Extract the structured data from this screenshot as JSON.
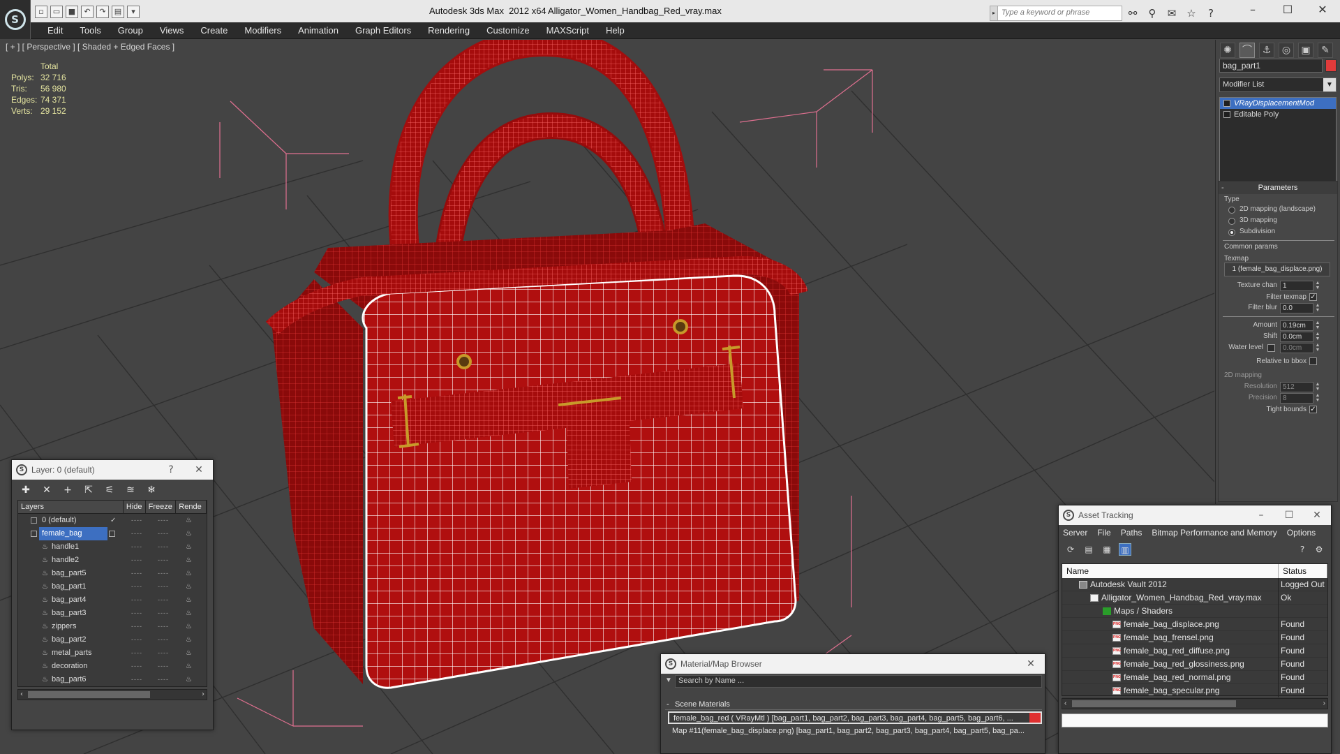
{
  "app": {
    "title": "Autodesk 3ds Max  2012 x64",
    "file": "Alligator_Women_Handbag_Red_vray.max",
    "search_placeholder": "Type a keyword or phrase"
  },
  "menu": [
    "Edit",
    "Tools",
    "Group",
    "Views",
    "Create",
    "Modifiers",
    "Animation",
    "Graph Editors",
    "Rendering",
    "Customize",
    "MAXScript",
    "Help"
  ],
  "viewport": {
    "label": "[ + ] [ Perspective ] [ Shaded + Edged Faces ]",
    "stats": {
      "total": "Total",
      "polys_label": "Polys:",
      "polys": "32 716",
      "tris_label": "Tris:",
      "tris": "56 980",
      "edges_label": "Edges:",
      "edges": "74 371",
      "verts_label": "Verts:",
      "verts": "29 152"
    },
    "colors": {
      "background": "#444444",
      "grid": "#2f2f2f",
      "wire": "#ffffff",
      "mesh": "#b00f0f",
      "bbox": "#e07090"
    }
  },
  "command_panel": {
    "object_name": "bag_part1",
    "modifier_list": "Modifier List",
    "stack": [
      "VRayDisplacementMod",
      "Editable Poly"
    ],
    "parameters": {
      "title": "Parameters",
      "type_label": "Type",
      "options": [
        "2D mapping (landscape)",
        "3D mapping",
        "Subdivision"
      ],
      "common_label": "Common params",
      "texmap_label": "Texmap",
      "texmap_value": "1 (female_bag_displace.png)",
      "texture_chan_label": "Texture chan",
      "texture_chan": "1",
      "filter_texmap_label": "Filter texmap",
      "filter_blur_label": "Filter blur",
      "filter_blur": "0.0",
      "amount_label": "Amount",
      "amount": "0.19cm",
      "shift_label": "Shift",
      "shift": "0.0cm",
      "water_level_label": "Water level",
      "water_level": "0.0cm",
      "relative_label": "Relative to bbox",
      "mapping2d_label": "2D mapping",
      "resolution_label": "Resolution",
      "resolution": "512",
      "precision_label": "Precision",
      "precision": "8",
      "tight_label": "Tight bounds"
    }
  },
  "layers": {
    "title": "Layer: 0 (default)",
    "help": "?",
    "columns": [
      "Layers",
      "Hide",
      "Freeze",
      "Rende"
    ],
    "items": [
      "0 (default)",
      "female_bag",
      "handle1",
      "handle2",
      "bag_part5",
      "bag_part1",
      "bag_part4",
      "bag_part3",
      "zippers",
      "bag_part2",
      "metal_parts",
      "decoration",
      "bag_part6",
      "female_bag"
    ],
    "dashes": "----"
  },
  "material_browser": {
    "title": "Material/Map Browser",
    "search": "Search by Name ...",
    "section": "Scene Materials",
    "rows": [
      "female_bag_red  ( VRayMtl ) [bag_part1, bag_part2, bag_part3, bag_part4, bag_part5, bag_part6, ...",
      "Map #11(female_bag_displace.png) [bag_part1, bag_part2, bag_part3, bag_part4, bag_part5, bag_pa..."
    ]
  },
  "asset_tracking": {
    "title": "Asset Tracking",
    "menu": [
      "Server",
      "File",
      "Paths",
      "Bitmap Performance and Memory",
      "Options"
    ],
    "columns": [
      "Name",
      "Status"
    ],
    "rows": [
      {
        "name": "Autodesk Vault 2012",
        "status": "Logged Out"
      },
      {
        "name": "Alligator_Women_Handbag_Red_vray.max",
        "status": "Ok"
      },
      {
        "name": "Maps / Shaders",
        "status": ""
      },
      {
        "name": "female_bag_displace.png",
        "status": "Found"
      },
      {
        "name": "female_bag_frensel.png",
        "status": "Found"
      },
      {
        "name": "female_bag_red_diffuse.png",
        "status": "Found"
      },
      {
        "name": "female_bag_red_glossiness.png",
        "status": "Found"
      },
      {
        "name": "female_bag_red_normal.png",
        "status": "Found"
      },
      {
        "name": "female_bag_specular.png",
        "status": "Found"
      }
    ]
  }
}
